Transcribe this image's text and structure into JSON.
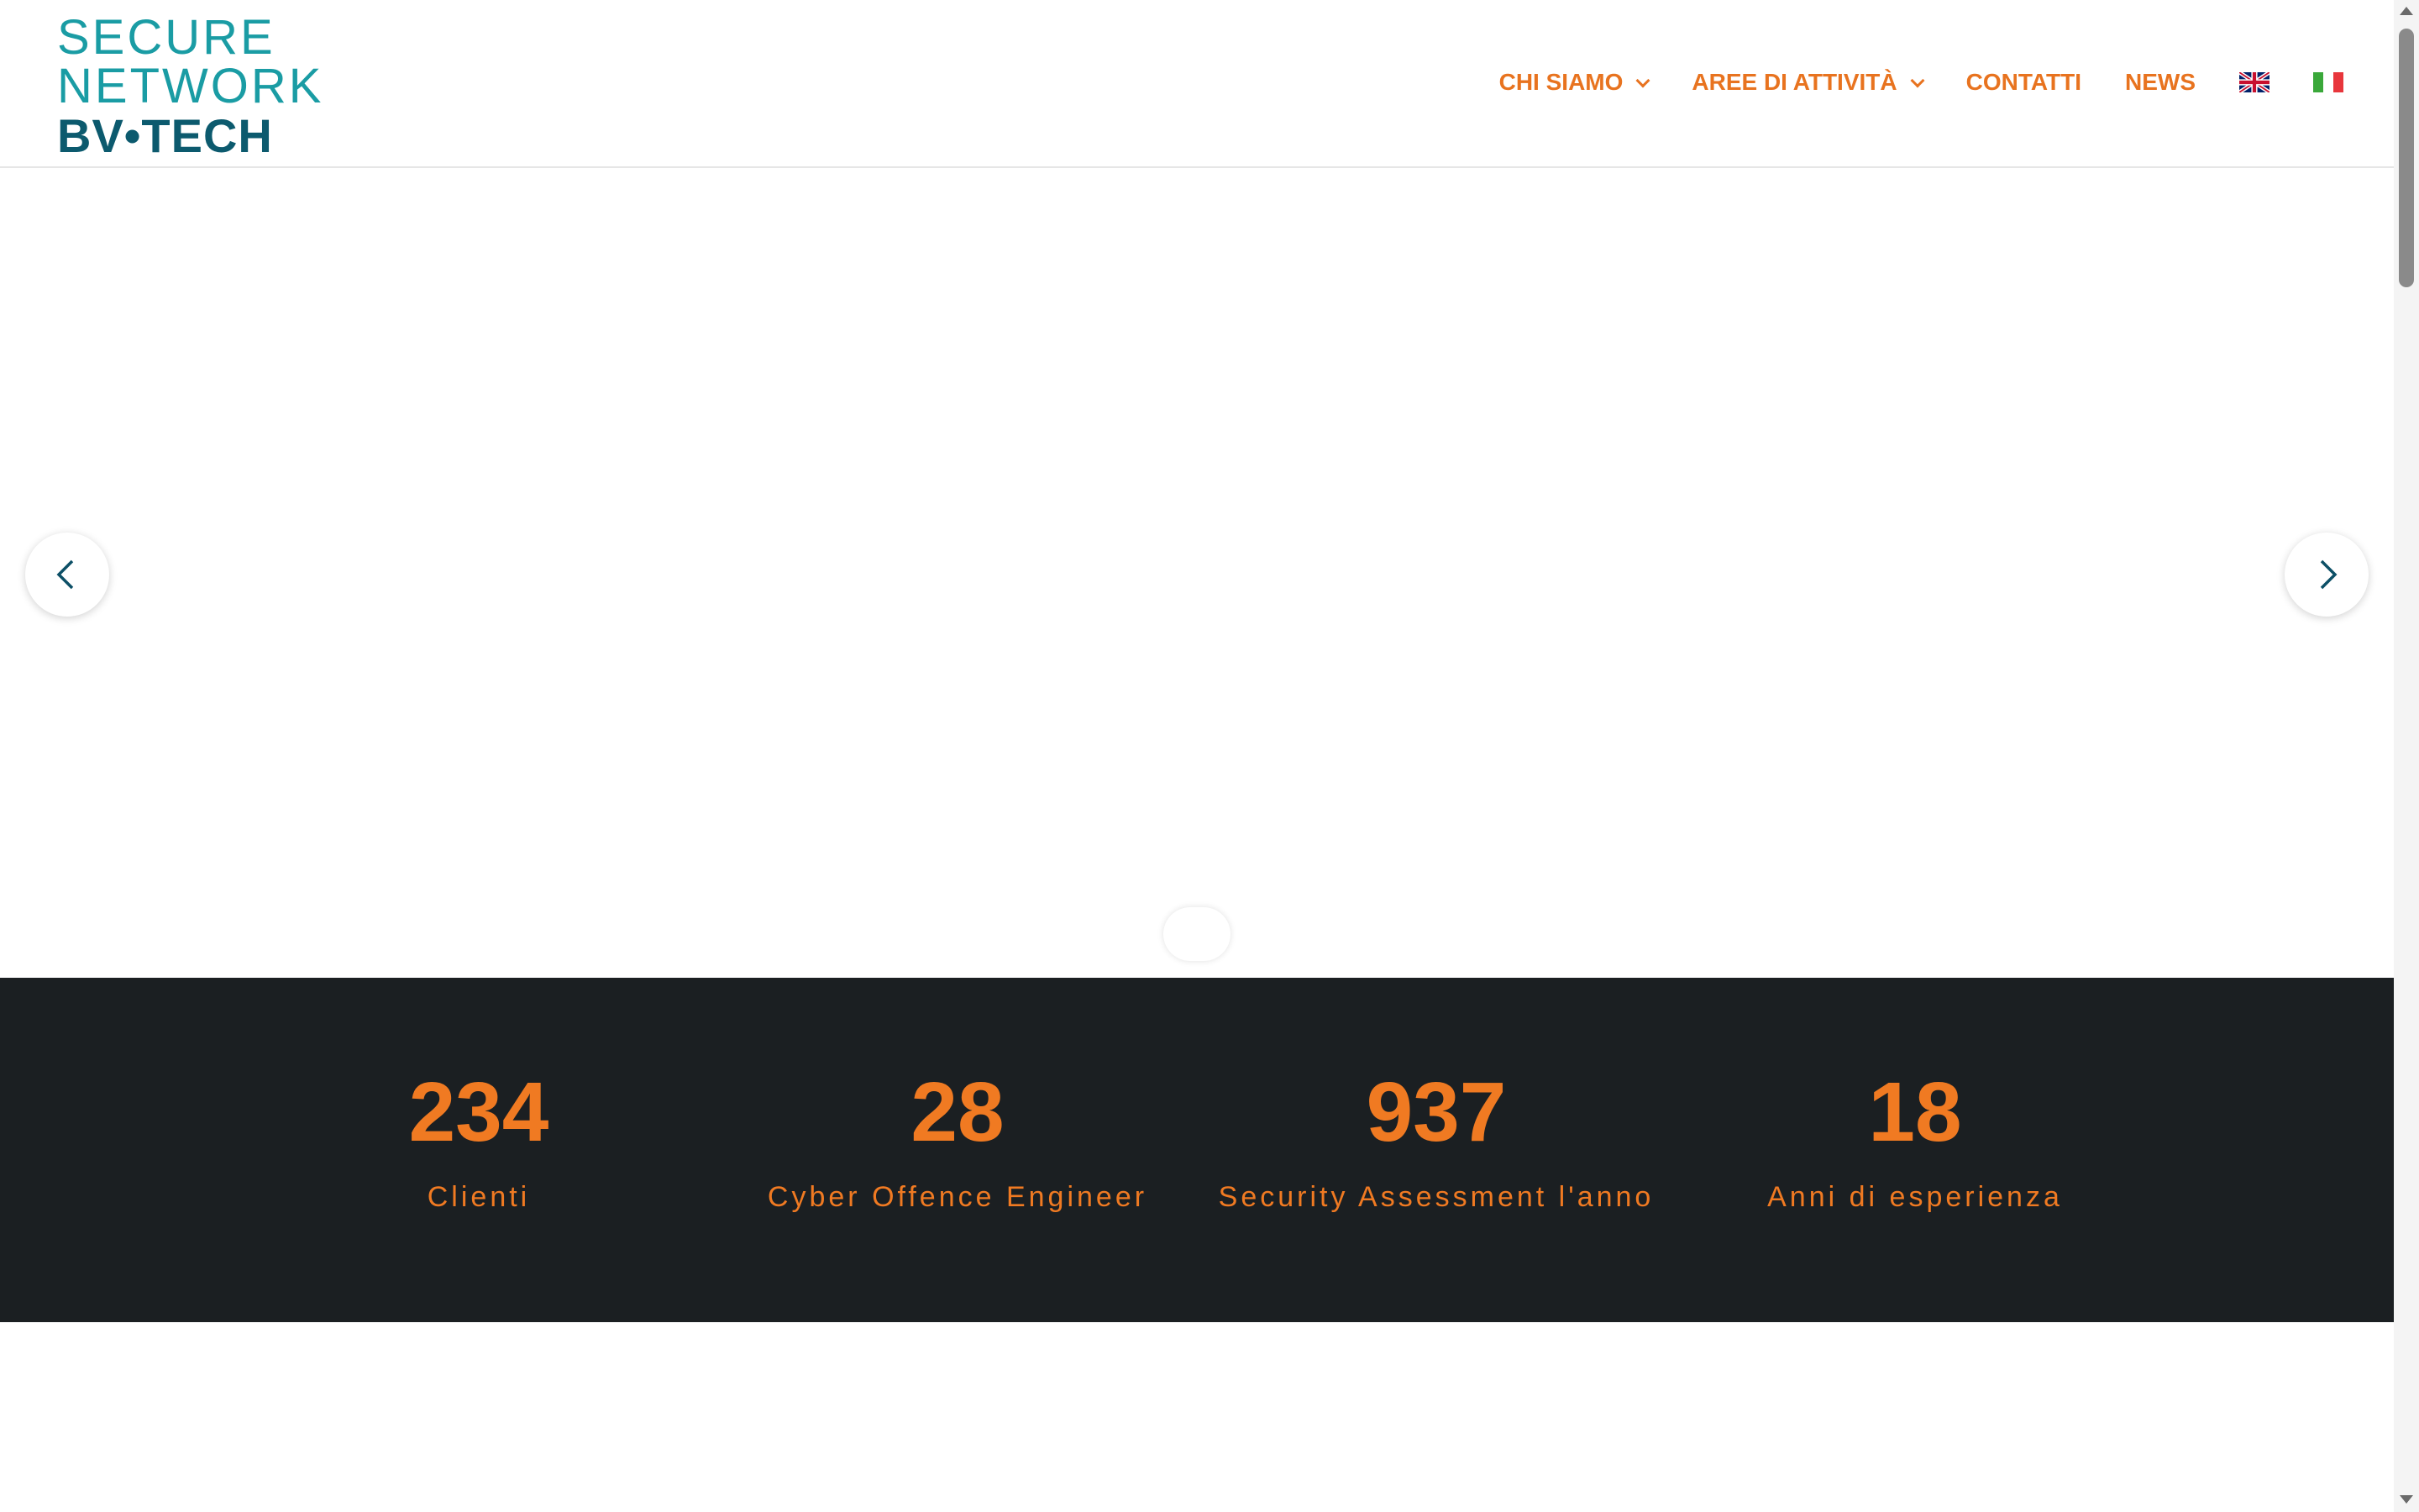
{
  "logo": {
    "line1": "SECURE",
    "line2": "NETWORK",
    "line3": "BV•TECH"
  },
  "nav": {
    "items": [
      {
        "label": "CHI SIAMO",
        "has_dropdown": true
      },
      {
        "label": "AREE DI ATTIVITÀ",
        "has_dropdown": true
      },
      {
        "label": "CONTATTI",
        "has_dropdown": false
      },
      {
        "label": "NEWS",
        "has_dropdown": false
      }
    ],
    "languages": [
      "uk-flag-icon",
      "italy-flag-icon"
    ]
  },
  "slider": {
    "prev_icon": "chevron-left-icon",
    "next_icon": "chevron-right-icon",
    "active_slide": 1,
    "slide_count": 1
  },
  "stats": [
    {
      "value": "234",
      "label": "Clienti"
    },
    {
      "value": "28",
      "label": "Cyber Offence Engineer"
    },
    {
      "value": "937",
      "label": "Security Assessment l'anno"
    },
    {
      "value": "18",
      "label": "Anni di esperienza"
    }
  ],
  "colors": {
    "accent": "#e8731f",
    "logo_teal": "#1a9ca4",
    "logo_dark": "#0c5a6e",
    "stats_bg": "#1b1f22",
    "arrow": "#0c4f66"
  }
}
